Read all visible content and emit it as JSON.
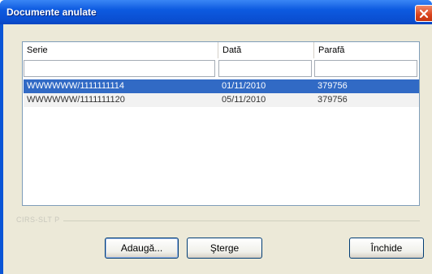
{
  "window": {
    "title": "Documente anulate",
    "close_icon": "close-icon"
  },
  "list": {
    "columns": [
      "Serie",
      "Dată",
      "Parafă"
    ],
    "filters": [
      "",
      "",
      ""
    ],
    "rows": [
      {
        "serie": "WWWWWW/1111111114",
        "data": "01/11/2010",
        "parafa": "379756",
        "selected": true
      },
      {
        "serie": "WWWWWW/1111111120",
        "data": "05/11/2010",
        "parafa": "379756",
        "selected": false
      }
    ]
  },
  "group": {
    "label": "CIRS-SLT P"
  },
  "buttons": {
    "add": "Adaugă...",
    "delete": "Şterge",
    "close": "Închide"
  },
  "colors": {
    "selection": "#316ac5",
    "titlebar": "#0a55d6",
    "dialog_bg": "#ece9d8"
  }
}
